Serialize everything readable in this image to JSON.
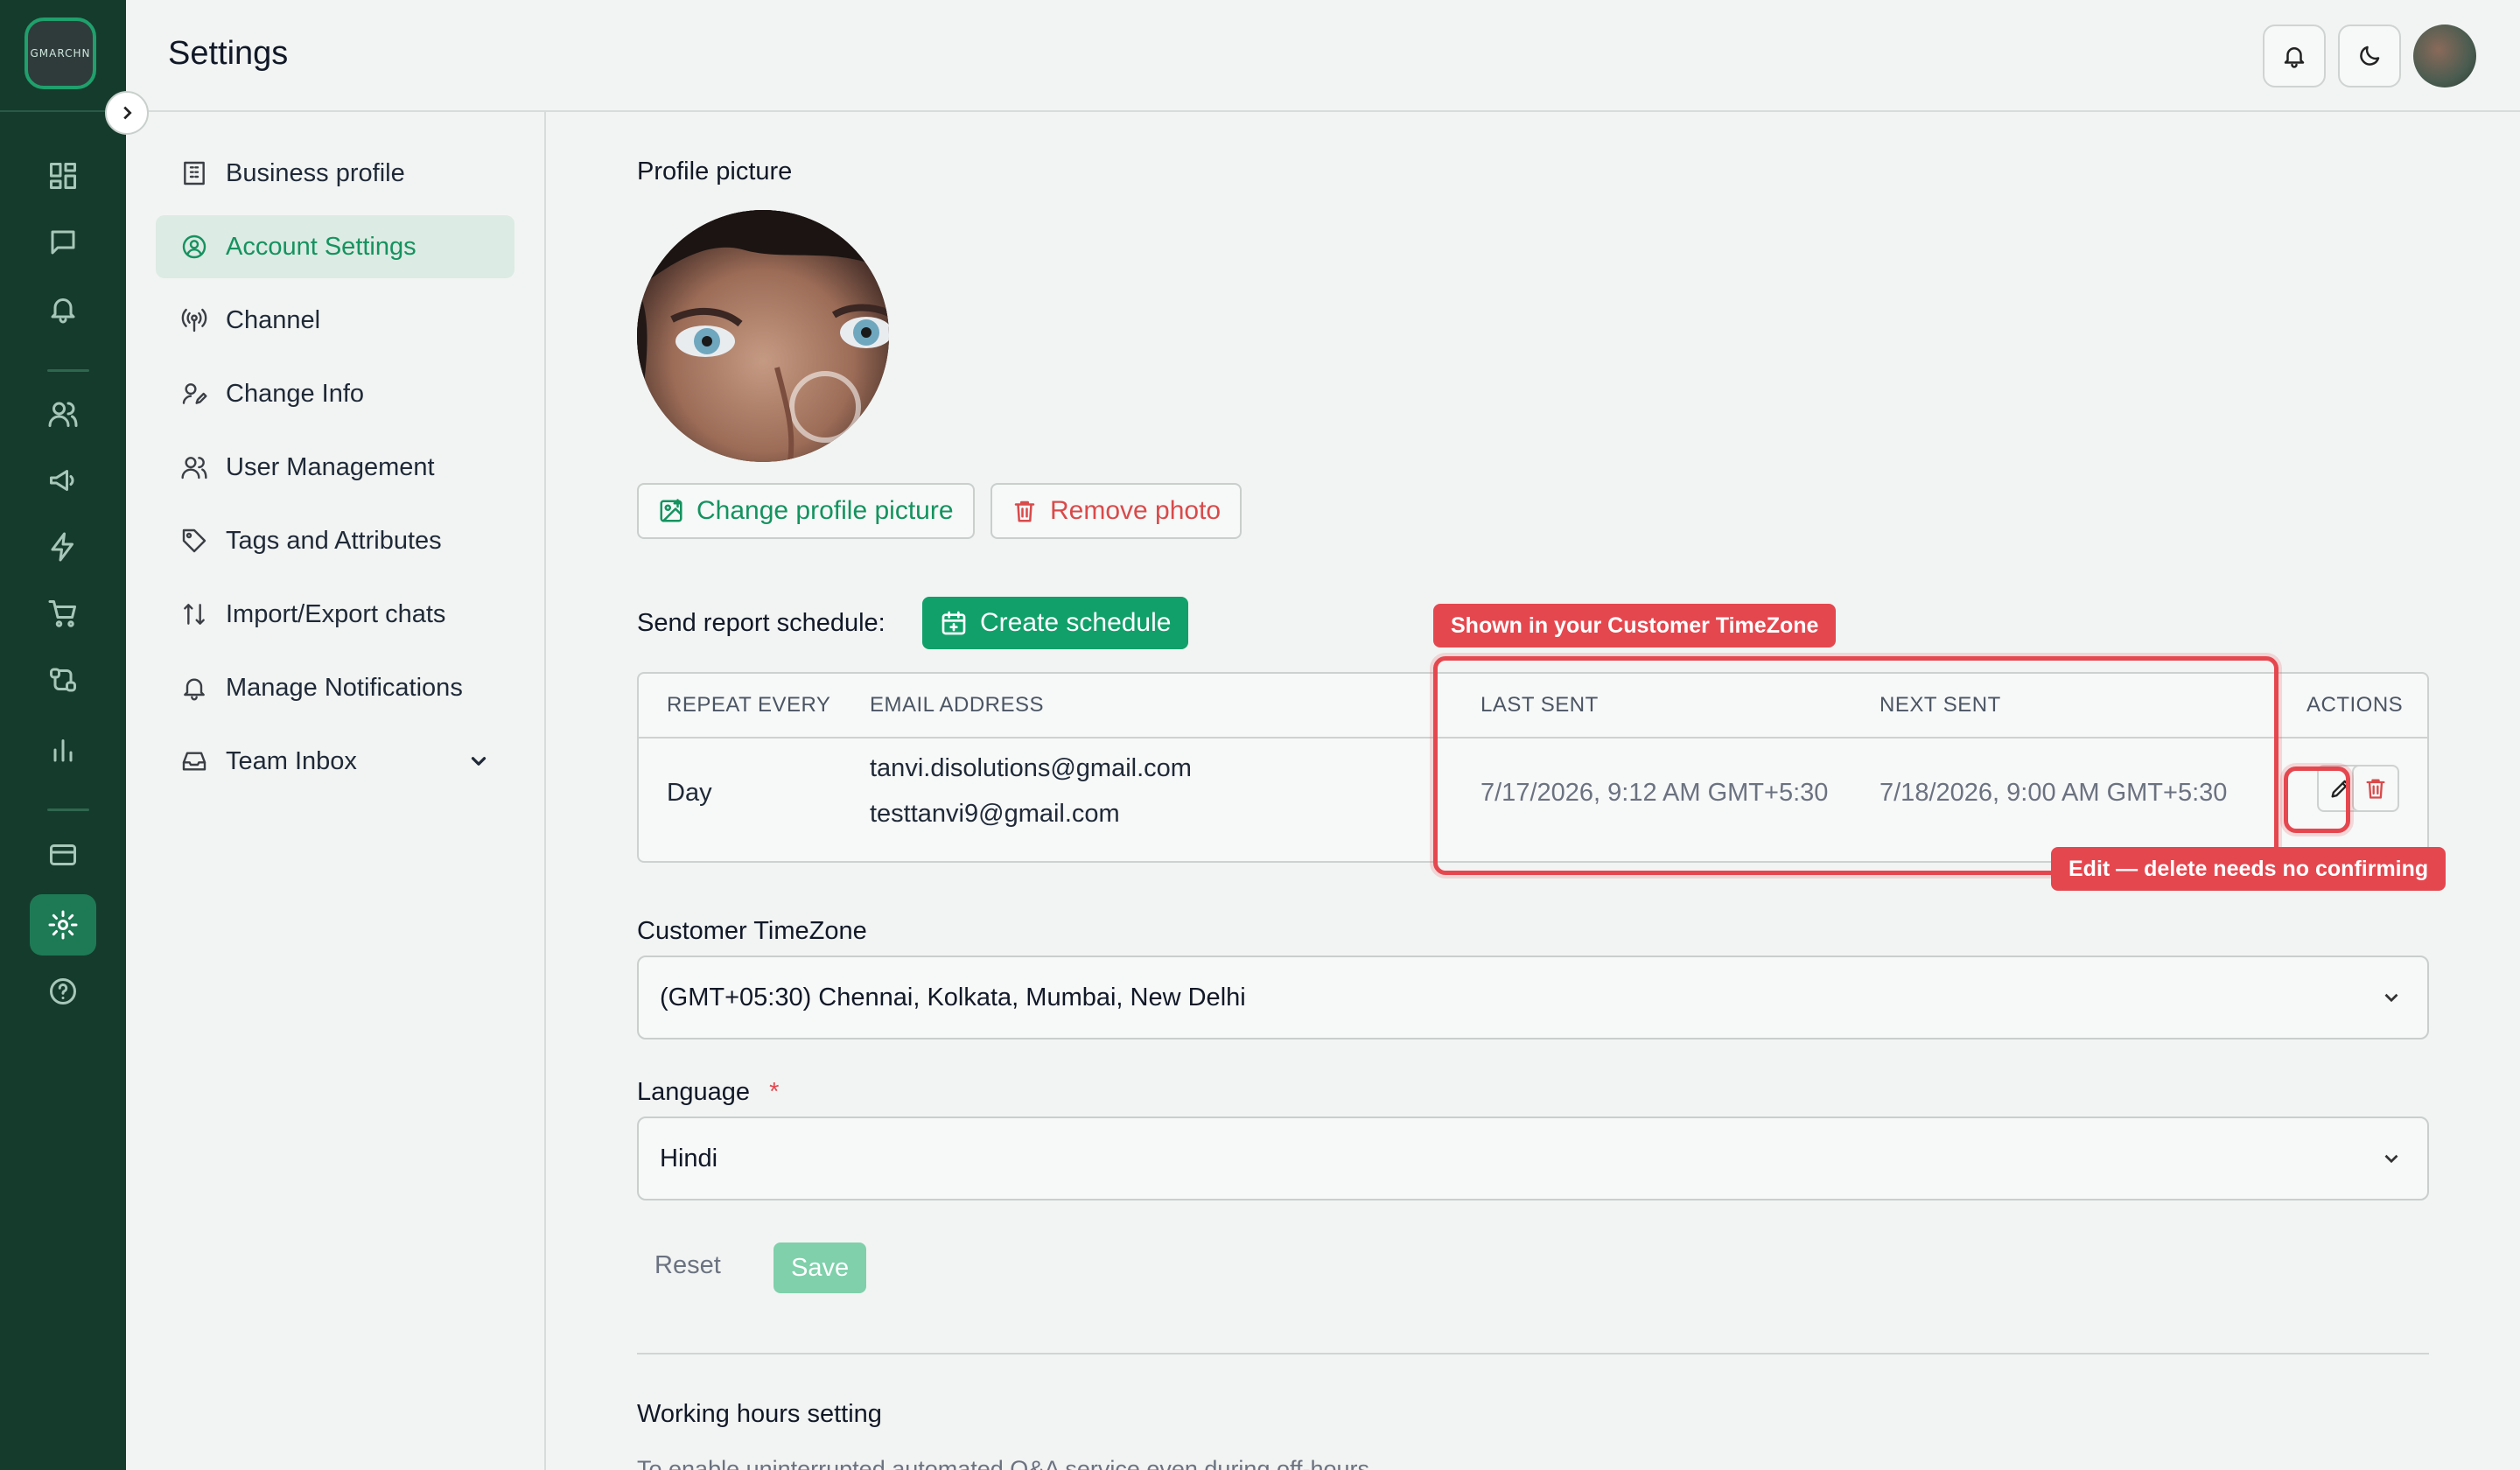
{
  "app": {
    "logo_text": "GMARCHN"
  },
  "header": {
    "title": "Settings"
  },
  "nav": [
    {
      "label": "Business profile"
    },
    {
      "label": "Account Settings"
    },
    {
      "label": "Channel"
    },
    {
      "label": "Change Info"
    },
    {
      "label": "User Management"
    },
    {
      "label": "Tags and Attributes"
    },
    {
      "label": "Import/Export chats"
    },
    {
      "label": "Manage Notifications"
    },
    {
      "label": "Team Inbox"
    }
  ],
  "profile": {
    "heading": "Profile picture",
    "change_label": "Change profile picture",
    "remove_label": "Remove photo"
  },
  "schedule": {
    "label": "Send report schedule:",
    "create_label": "Create schedule",
    "columns": [
      "REPEAT EVERY",
      "EMAIL ADDRESS",
      "LAST SENT",
      "NEXT SENT",
      "ACTIONS"
    ],
    "rows": [
      {
        "repeat": "Day",
        "emails": [
          "tanvi.disolutions@gmail.com",
          "testtanvi9@gmail.com"
        ],
        "last_sent": "7/17/2026, 9:12 AM GMT+5:30",
        "next_sent": "7/18/2026, 9:00 AM GMT+5:30"
      }
    ]
  },
  "annotations": {
    "timezone_note": "Shown in your Customer TimeZone",
    "actions_note": "Edit — delete needs no confirming"
  },
  "timezone": {
    "label": "Customer TimeZone",
    "value": "(GMT+05:30) Chennai, Kolkata, Mumbai, New Delhi"
  },
  "language": {
    "label": "Language",
    "required_mark": "*",
    "value": "Hindi"
  },
  "form": {
    "reset_label": "Reset",
    "save_label": "Save"
  },
  "working_hours": {
    "heading": "Working hours setting",
    "description": "To enable uninterrupted automated Q&A service even during off-hours"
  },
  "colors": {
    "brand": "#153b2c",
    "accent": "#11a06a",
    "danger": "#e5474f"
  }
}
